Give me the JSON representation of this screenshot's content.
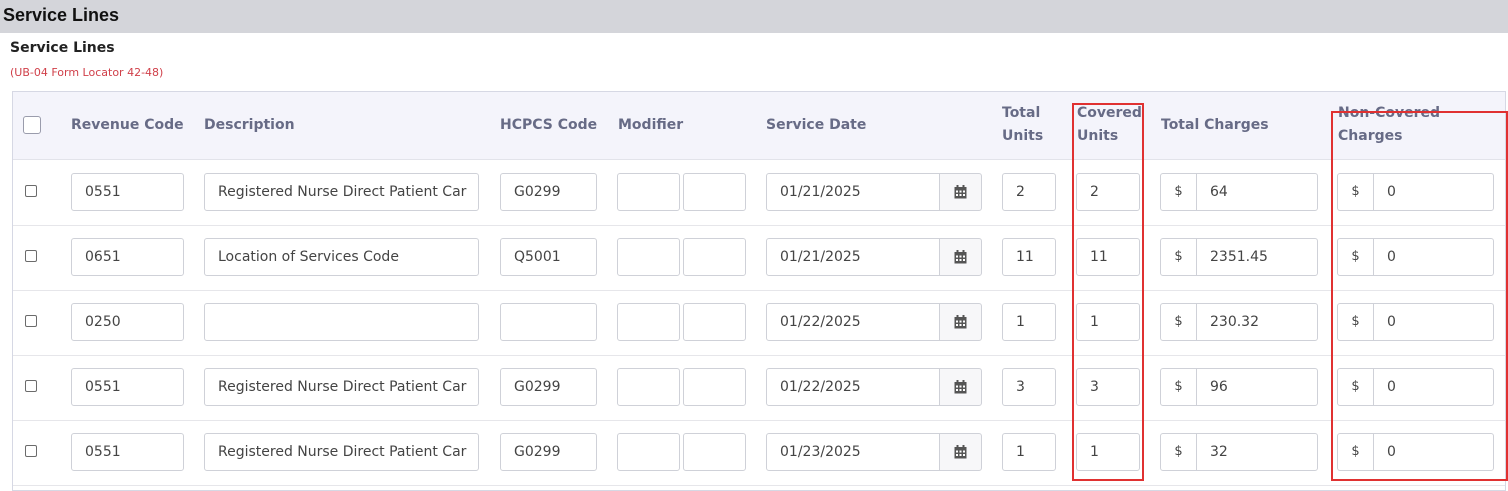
{
  "header": {
    "title": "Service Lines"
  },
  "section": {
    "title": "Service Lines",
    "subtitle": "(UB-04 Form Locator 42-48)"
  },
  "columns": {
    "revenue_code": "Revenue Code",
    "description": "Description",
    "hcpcs_code": "HCPCS Code",
    "modifier": "Modifier",
    "service_date": "Service Date",
    "total_units_1": "Total",
    "total_units_2": "Units",
    "covered_units_1": "Covered",
    "covered_units_2": "Units",
    "total_charges": "Total Charges",
    "non_covered_1": "Non-Covered",
    "non_covered_2": "Charges"
  },
  "currency_symbol": "$",
  "rows": [
    {
      "revenue_code": "0551",
      "description": "Registered Nurse Direct Patient Car",
      "hcpcs": "G0299",
      "modifier1": "",
      "modifier2": "",
      "service_date": "01/21/2025",
      "total_units": "2",
      "covered_units": "2",
      "total_charges": "64",
      "non_covered": "0"
    },
    {
      "revenue_code": "0651",
      "description": "Location of Services Code",
      "hcpcs": "Q5001",
      "modifier1": "",
      "modifier2": "",
      "service_date": "01/21/2025",
      "total_units": "11",
      "covered_units": "11",
      "total_charges": "2351.45",
      "non_covered": "0"
    },
    {
      "revenue_code": "0250",
      "description": "",
      "hcpcs": "",
      "modifier1": "",
      "modifier2": "",
      "service_date": "01/22/2025",
      "total_units": "1",
      "covered_units": "1",
      "total_charges": "230.32",
      "non_covered": "0"
    },
    {
      "revenue_code": "0551",
      "description": "Registered Nurse Direct Patient Car",
      "hcpcs": "G0299",
      "modifier1": "",
      "modifier2": "",
      "service_date": "01/22/2025",
      "total_units": "3",
      "covered_units": "3",
      "total_charges": "96",
      "non_covered": "0"
    },
    {
      "revenue_code": "0551",
      "description": "Registered Nurse Direct Patient Car",
      "hcpcs": "G0299",
      "modifier1": "",
      "modifier2": "",
      "service_date": "01/23/2025",
      "total_units": "1",
      "covered_units": "1",
      "total_charges": "32",
      "non_covered": "0"
    }
  ],
  "icons": {
    "calendar": "calendar-icon"
  },
  "colors": {
    "highlight": "#e03131",
    "subtitle": "#d0404a",
    "header_text": "#676b86"
  }
}
